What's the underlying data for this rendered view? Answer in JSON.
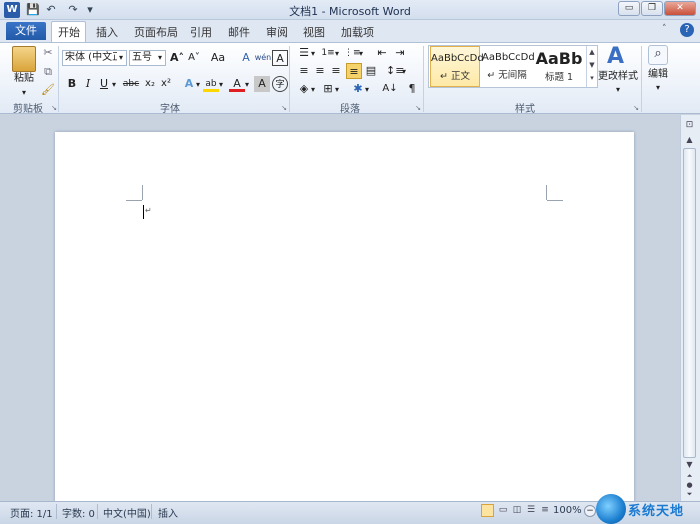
{
  "window": {
    "title": "文档1 - Microsoft Word",
    "app_icon": "W",
    "minimize": "▭",
    "restore": "❐",
    "close": "✕"
  },
  "quick_access": {
    "save_icon": "💾",
    "undo_icon": "↶",
    "redo_icon": "↷",
    "customize_icon": "▾"
  },
  "tabs": {
    "file": "文件",
    "items": [
      "开始",
      "插入",
      "页面布局",
      "引用",
      "邮件",
      "审阅",
      "视图",
      "加载项"
    ]
  },
  "ribbon": {
    "clipboard": {
      "label": "剪贴板",
      "paste_label": "粘贴"
    },
    "font": {
      "label": "字体",
      "font_name": "宋体 (中文正文)",
      "font_size": "五号",
      "bold": "B",
      "italic": "I",
      "underline": "U",
      "strike": "abc",
      "subscript": "x₂",
      "superscript": "x²",
      "grow": "A˄",
      "shrink": "A˅",
      "change_case": "Aa",
      "clear_format": "A",
      "phonetic": "wén",
      "char_border": "A",
      "text_effect": "A",
      "highlight": "ab",
      "font_color": "A",
      "char_shading": "A",
      "enclose": "字"
    },
    "paragraph": {
      "label": "段落"
    },
    "styles": {
      "label": "样式",
      "items": [
        {
          "sample": "AaBbCcDd",
          "name": "↵ 正文"
        },
        {
          "sample": "AaBbCcDd",
          "name": "↵ 无间隔"
        },
        {
          "sample": "AaBb",
          "name": "标题 1"
        }
      ],
      "change_styles": "更改样式"
    },
    "editing": {
      "label": "编辑"
    }
  },
  "status": {
    "page": "页面: 1/1",
    "words": "字数: 0",
    "language": "中文(中国)",
    "insert_mode": "插入",
    "zoom": "100%",
    "zoom_minus": "−",
    "zoom_plus": "+"
  },
  "watermark": {
    "text": "系统天地"
  },
  "colors": {
    "file_tab": "#2a64b4",
    "highlight": "#ffd700",
    "font_color": "#e02020"
  }
}
